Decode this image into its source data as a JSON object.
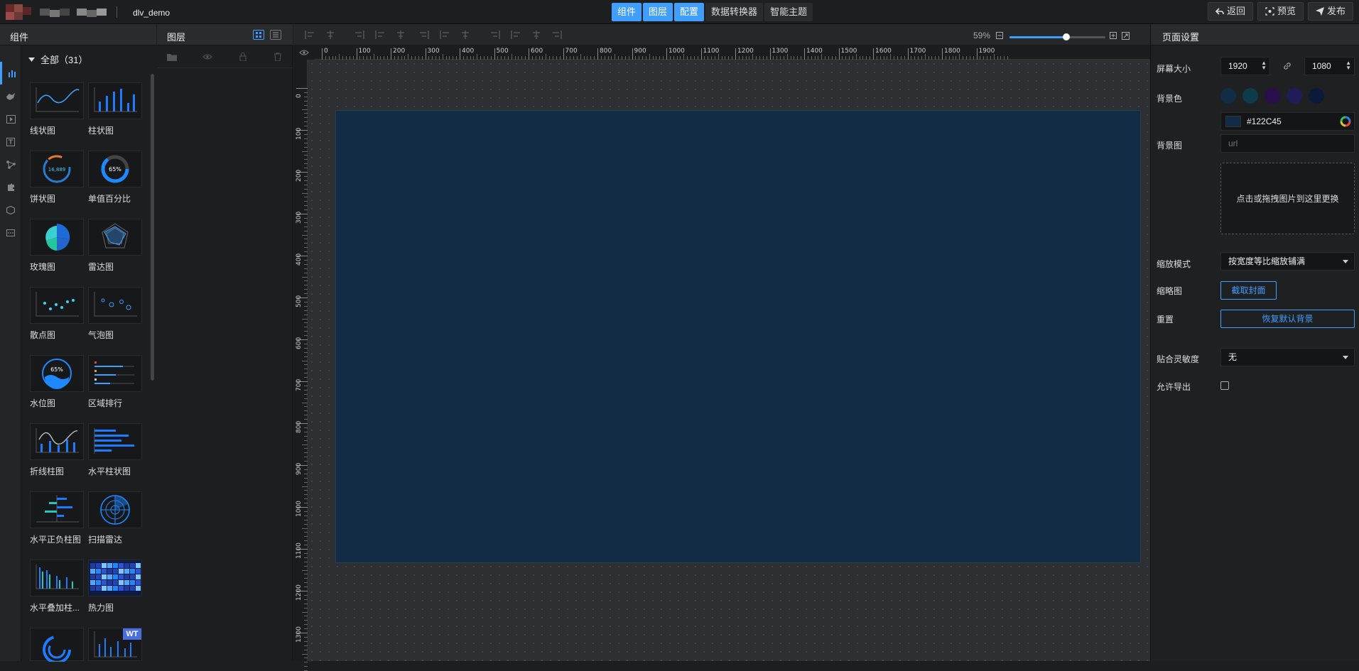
{
  "header": {
    "app_name": "dlv_demo",
    "tabs": [
      {
        "label": "组件",
        "active": true
      },
      {
        "label": "图层",
        "active": true
      },
      {
        "label": "配置",
        "active": true
      },
      {
        "label": "数据转换器",
        "active": false
      },
      {
        "label": "智能主题",
        "active": false
      }
    ],
    "back_label": "返回",
    "preview_label": "预览",
    "publish_label": "发布"
  },
  "components": {
    "title": "组件",
    "all_label": "全部（31）",
    "badge": "WT",
    "items": [
      {
        "name": "线状图",
        "icon": "line-chart-thumb"
      },
      {
        "name": "柱状图",
        "icon": "bar-chart-thumb"
      },
      {
        "name": "饼状图",
        "icon": "pie-chart-thumb",
        "value_text": "16,889"
      },
      {
        "name": "单值百分比",
        "icon": "percent-ring-thumb",
        "value_text": "65%"
      },
      {
        "name": "玫瑰图",
        "icon": "rose-chart-thumb"
      },
      {
        "name": "雷达图",
        "icon": "radar-chart-thumb"
      },
      {
        "name": "散点图",
        "icon": "scatter-chart-thumb"
      },
      {
        "name": "气泡图",
        "icon": "bubble-chart-thumb"
      },
      {
        "name": "水位图",
        "icon": "water-level-thumb",
        "value_text": "65%"
      },
      {
        "name": "区域排行",
        "icon": "area-ranking-thumb"
      },
      {
        "name": "折线柱图",
        "icon": "line-bar-thumb"
      },
      {
        "name": "水平柱状图",
        "icon": "horizontal-bar-thumb"
      },
      {
        "name": "水平正负柱图",
        "icon": "pos-neg-bar-thumb"
      },
      {
        "name": "扫描雷达",
        "icon": "scan-radar-thumb"
      },
      {
        "name": "水平叠加柱...",
        "icon": "stacked-bar-thumb"
      },
      {
        "name": "热力图",
        "icon": "heatmap-thumb"
      }
    ]
  },
  "layers": {
    "title": "图层"
  },
  "canvas": {
    "zoom": "59%",
    "zoom_fraction": 0.59,
    "screen_color": "#122C45",
    "ruler_h": [
      "0",
      "100",
      "200",
      "300",
      "400",
      "500",
      "600",
      "700",
      "800",
      "900",
      "1000",
      "1100",
      "1200",
      "1300",
      "1400",
      "1500",
      "1600",
      "1700",
      "1800",
      "1900"
    ],
    "ruler_v": [
      "0",
      "100",
      "200",
      "300",
      "400",
      "500",
      "600",
      "700",
      "800",
      "900",
      "1000",
      "1100",
      "1200",
      "1300"
    ]
  },
  "props": {
    "title": "页面设置",
    "screen_size_label": "屏幕大小",
    "width": "1920",
    "height": "1080",
    "bg_color_label": "背景色",
    "swatches": [
      "#122C45",
      "#0D3B4A",
      "#2A0F4A",
      "#1F1D57",
      "#0A1A3A"
    ],
    "bg_color_value": "#122C45",
    "bg_image_label": "背景图",
    "bg_image_placeholder": "url",
    "upload_text": "点击或拖拽图片到这里更换",
    "scale_mode_label": "缩放模式",
    "scale_mode_value": "按宽度等比缩放铺满",
    "thumbnail_label": "缩略图",
    "capture_label": "截取封面",
    "reset_label": "重置",
    "restore_label": "恢复默认背景",
    "snap_label": "贴合灵敏度",
    "snap_value": "无",
    "export_label": "允许导出"
  }
}
